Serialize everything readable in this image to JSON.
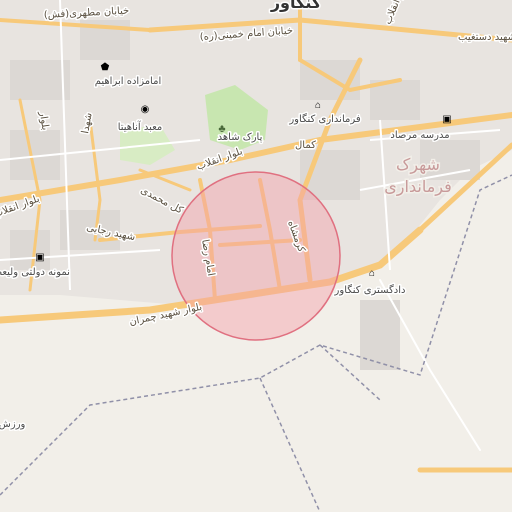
{
  "map": {
    "city_label": "کنگاور",
    "district_label_line1": "شهرک",
    "district_label_line2": "فرمانداری",
    "roads": {
      "motahari": "خیابان مطهری(فش)",
      "khomeini": "خیابان امام خمینی(ره)",
      "enghelab_top": "بلوار انقلاب",
      "dastgheib": "شهید دستغیب",
      "enghelab_main": "بلوار انقلاب",
      "enghelab_west": "بلوار انقلاب",
      "kamal": "کمال",
      "mohammadi": "کل محمدی",
      "rajaei": "شهید رجایی",
      "imamreza": "امام رضا",
      "kermanshah": "کرمشاه",
      "chamran": "بلوار شهید چمران",
      "west_blvd": "بلوار",
      "shohada": "شهدا"
    },
    "pois": {
      "emamzadeh": "امامزاده ابراهیم",
      "anahita": "معبد آناهیتا",
      "park": "پارک شاهد",
      "farmandari": "فرمانداری کنگاور",
      "school": "مدرسه مرصاد",
      "dolati": "نمونه دولتی ولیعص",
      "dadgostari": "دادگستری کنگاور",
      "varzesh": "ورزش"
    },
    "circle_color": "#f4a0a8",
    "road_color": "#f7c97a",
    "park_color": "#c8e6b0"
  }
}
